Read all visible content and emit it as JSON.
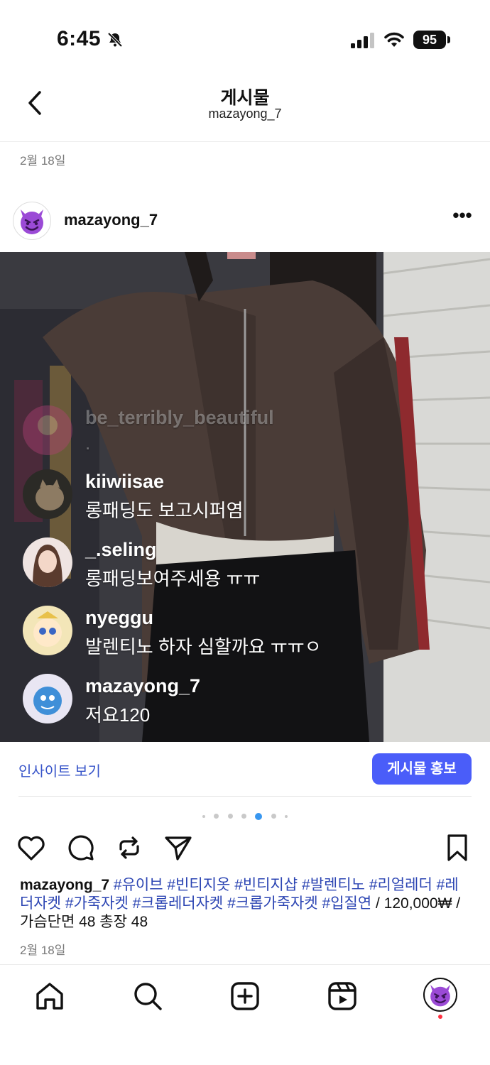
{
  "status": {
    "time": "6:45",
    "battery": "95"
  },
  "header": {
    "title": "게시물",
    "subtitle": "mazayong_7"
  },
  "post": {
    "date_top": "2월 18일",
    "username": "mazayong_7",
    "more_icon": "•••",
    "comments": [
      {
        "name": "be_terribly_beautiful",
        "text": ".",
        "faded": true
      },
      {
        "name": "kiiwiisae",
        "text": "롱패딩도 보고시퍼염"
      },
      {
        "name": "_.seling",
        "text": "롱패딩보여주세용 ㅠㅠ"
      },
      {
        "name": "nyeggu",
        "text": "발렌티노 하자 심할까요 ㅠㅠㅇ"
      },
      {
        "name": "mazayong_7",
        "text": "저요120"
      }
    ]
  },
  "insights": {
    "link": "인사이트 보기",
    "promote": "게시물 홍보"
  },
  "carousel": {
    "count": 7,
    "active_index": 4
  },
  "caption": {
    "username": "mazayong_7",
    "tags": [
      "#유이브",
      "#빈티지옷",
      "#빈티지샵",
      "#발렌티노",
      "#리얼레더",
      "#레더자켓",
      "#가죽자켓",
      "#크롭레더자켓",
      "#크롭가죽자켓",
      "#입질연"
    ],
    "text": " / 120,000₩ / 가슴단면 48 총장 48",
    "date": "2월 18일"
  },
  "colors": {
    "accent": "#4a5df9",
    "link": "#3754c9",
    "notification": "#ff3040",
    "carousel_active": "#3897f0"
  },
  "icons": {
    "status": [
      "bell-slash-icon",
      "signal-icon",
      "wifi-icon",
      "battery-icon"
    ],
    "actions": [
      "heart-icon",
      "comment-icon",
      "repost-icon",
      "send-icon",
      "bookmark-icon"
    ],
    "nav": [
      "home-icon",
      "search-icon",
      "create-icon",
      "reels-icon",
      "profile-avatar"
    ]
  }
}
